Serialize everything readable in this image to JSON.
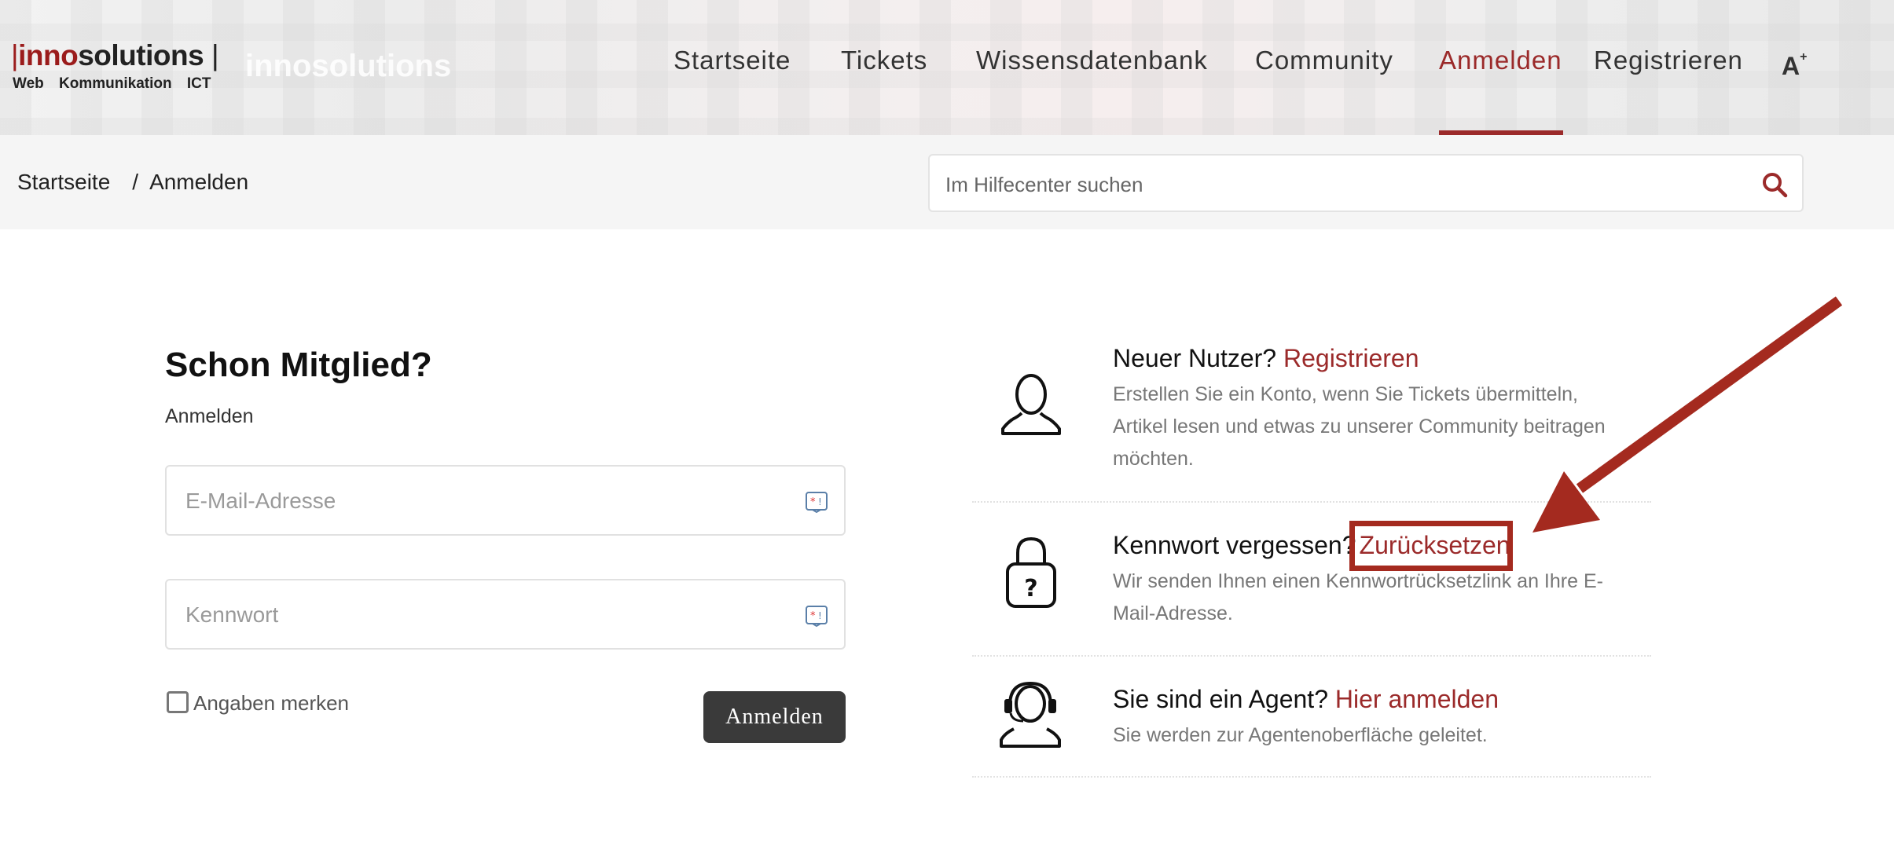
{
  "header": {
    "logo_text_inno": "inno",
    "logo_text_solutions": "solutions",
    "logo_tagline": "Web Kommunikation ICT",
    "logo_ghost": "innosolutions",
    "nav": [
      {
        "label": "Startseite",
        "active": false
      },
      {
        "label": "Tickets",
        "active": false
      },
      {
        "label": "Wissensdatenbank",
        "active": false
      },
      {
        "label": "Community",
        "active": false
      },
      {
        "label": "Anmelden",
        "active": true
      },
      {
        "label": "Registrieren",
        "active": false
      }
    ],
    "a11y_icon": "font-size-icon",
    "accent_color": "#9b2a2a"
  },
  "breadcrumb": {
    "home": "Startseite",
    "separator": "/",
    "current": "Anmelden"
  },
  "search": {
    "placeholder": "Im Hilfecenter suchen",
    "icon": "search-icon"
  },
  "login": {
    "title": "Schon Mitglied?",
    "subtitle": "Anmelden",
    "email_placeholder": "E-Mail-Adresse",
    "password_placeholder": "Kennwort",
    "remember_label": "Angaben merken",
    "submit_label": "Anmelden"
  },
  "info": {
    "register": {
      "title": "Neuer Nutzer?",
      "link": "Registrieren",
      "text": "Erstellen Sie ein Konto, wenn Sie Tickets übermitteln, Artikel lesen und etwas zu unserer Community beitragen möchten.",
      "icon": "user-icon"
    },
    "reset": {
      "title": "Kennwort vergessen?",
      "link": "Zurücksetzen",
      "text": "Wir senden Ihnen einen Kennwortrücksetzlink an Ihre E-Mail-Adresse.",
      "icon": "lock-question-icon"
    },
    "agent": {
      "title": "Sie sind ein Agent?",
      "link": "Hier anmelden",
      "text": "Sie werden zur Agentenoberfläche geleitet.",
      "icon": "headset-agent-icon"
    }
  },
  "annotation": {
    "color": "#a42a1f",
    "target": "Zurücksetzen"
  }
}
